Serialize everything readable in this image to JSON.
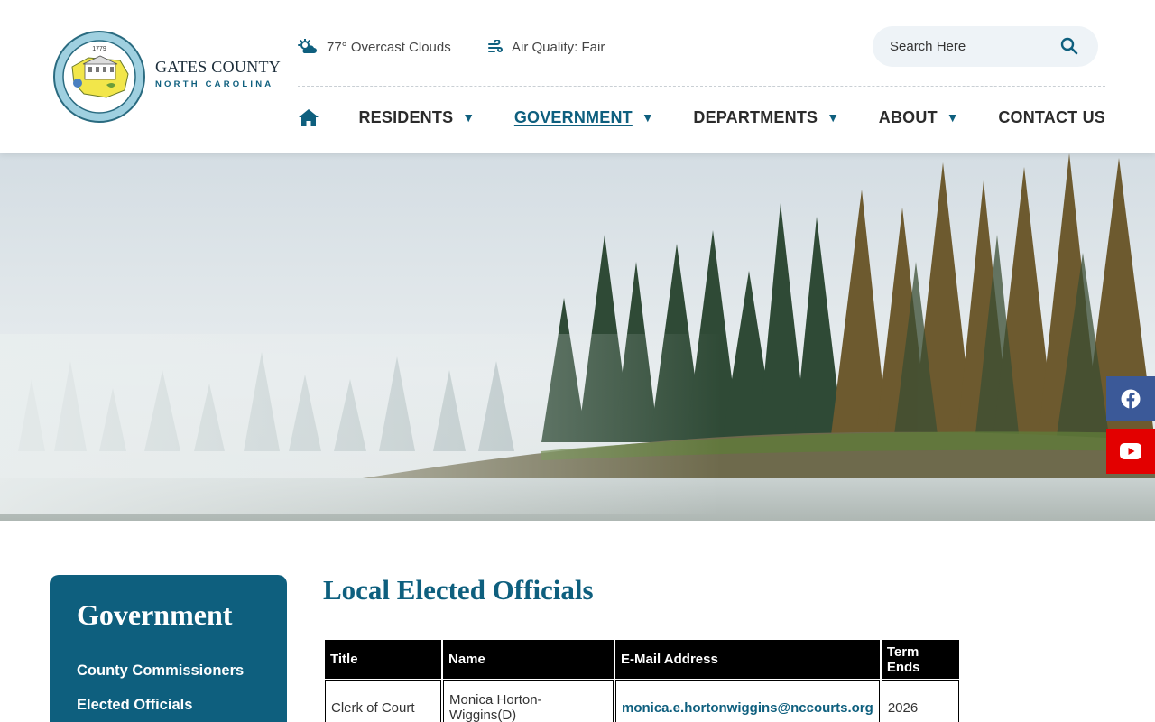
{
  "brand": {
    "name": "GATES COUNTY",
    "subtitle": "NORTH CAROLINA",
    "seal_year": "1779"
  },
  "utility": {
    "weather": "77° Overcast Clouds",
    "weather_icon": "weather-cloud-sun-icon",
    "air_quality": "Air Quality: Fair",
    "air_icon": "wind-icon"
  },
  "search": {
    "placeholder": "Search Here"
  },
  "nav": {
    "home_icon": "home-icon",
    "items": [
      {
        "label": "RESIDENTS",
        "caret": "▼"
      },
      {
        "label": "GOVERNMENT",
        "caret": "▼"
      },
      {
        "label": "DEPARTMENTS",
        "caret": "▼"
      },
      {
        "label": "ABOUT",
        "caret": "▼"
      },
      {
        "label": "CONTACT US"
      }
    ],
    "active_index": 1
  },
  "social": {
    "facebook_icon": "facebook-icon",
    "youtube_icon": "youtube-icon",
    "facebook_color": "#3b5998",
    "youtube_color": "#e30000"
  },
  "sidebar": {
    "title": "Government",
    "links": [
      "County Commissioners",
      "Elected Officials"
    ]
  },
  "main": {
    "title": "Local Elected Officials",
    "table": {
      "headers": [
        "Title",
        "Name",
        "E-Mail Address",
        "Term Ends"
      ],
      "rows": [
        [
          "Clerk of Court",
          "Monica Horton-Wiggins(D)",
          "monica.e.hortonwiggins@nccourts.org",
          "2026"
        ]
      ]
    }
  },
  "colors": {
    "accent": "#0e5f7e",
    "header_bg": "#ffffff",
    "table_header_bg": "#000000"
  }
}
